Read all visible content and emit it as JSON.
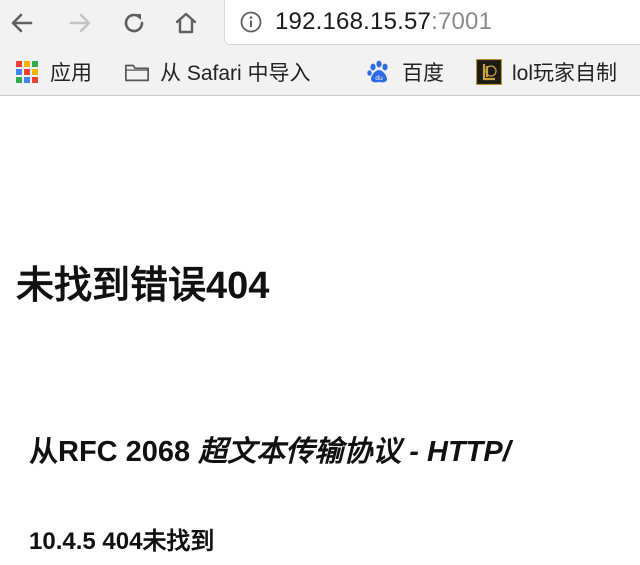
{
  "browser": {
    "nav": {
      "back_icon": "arrow-left-icon",
      "forward_icon": "arrow-right-icon",
      "reload_icon": "reload-icon",
      "home_icon": "home-icon"
    },
    "address": {
      "host": "192.168.15.57",
      "port": ":7001",
      "info_icon": "info-icon"
    }
  },
  "bookmarks": [
    {
      "label": "应用",
      "icon": "apps-grid-icon"
    },
    {
      "label": "从 Safari 中导入",
      "icon": "folder-icon"
    },
    {
      "label": "百度",
      "icon": "baidu-paw-icon"
    },
    {
      "label": "lol玩家自制",
      "icon": "lol-logo-icon"
    }
  ],
  "page": {
    "title": "未找到错误404",
    "subtitle_prefix": "从RFC 2068 ",
    "subtitle_italic": "超文本传输协议 - HTTP/",
    "section": "10.4.5 404未找到"
  },
  "colors": {
    "toolbar_bg": "#f2f2f2",
    "url_port": "#8a8a8a",
    "baidu_blue": "#2e6be6"
  }
}
